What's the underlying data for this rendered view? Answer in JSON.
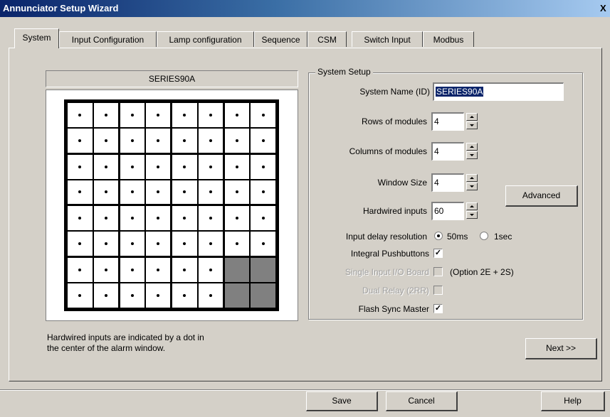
{
  "window": {
    "title": "Annunciator Setup Wizard",
    "close_label": "X"
  },
  "tabs": [
    {
      "label": "System",
      "active": true
    },
    {
      "label": "Input Configuration"
    },
    {
      "label": "Lamp configuration"
    },
    {
      "label": "Sequence"
    },
    {
      "label": "CSM"
    },
    {
      "label": "Switch Input"
    },
    {
      "label": "Modbus"
    }
  ],
  "preview": {
    "name": "SERIES90A",
    "rows": 8,
    "cols": 8,
    "inactive_cells": [
      "6-6",
      "6-7",
      "7-6",
      "7-7"
    ]
  },
  "system_setup": {
    "group_title": "System Setup",
    "system_name_label": "System Name (ID)",
    "system_name_value": "SERIES90A",
    "rows_label": "Rows of modules",
    "rows_value": "4",
    "columns_label": "Columns of modules",
    "columns_value": "4",
    "window_size_label": "Window Size",
    "window_size_value": "4",
    "hardwired_label": "Hardwired inputs",
    "hardwired_value": "60",
    "advanced_label": "Advanced",
    "input_delay_label": "Input delay resolution",
    "input_delay_options": [
      "50ms",
      "1sec"
    ],
    "input_delay_selected": "50ms",
    "integral_pushbuttons_label": "Integral Pushbuttons",
    "integral_pushbuttons_checked": true,
    "single_input_label": "Single Input I/O Board",
    "single_input_note": "(Option 2E + 2S)",
    "dual_relay_label": "Dual Relay (2RR)",
    "flash_sync_label": "Flash Sync Master",
    "flash_sync_checked": true
  },
  "hint": {
    "line1": "Hardwired inputs are indicated by a dot in",
    "line2": "the center of the alarm window."
  },
  "buttons": {
    "next": "Next >>",
    "save": "Save",
    "cancel": "Cancel",
    "help": "Help"
  }
}
